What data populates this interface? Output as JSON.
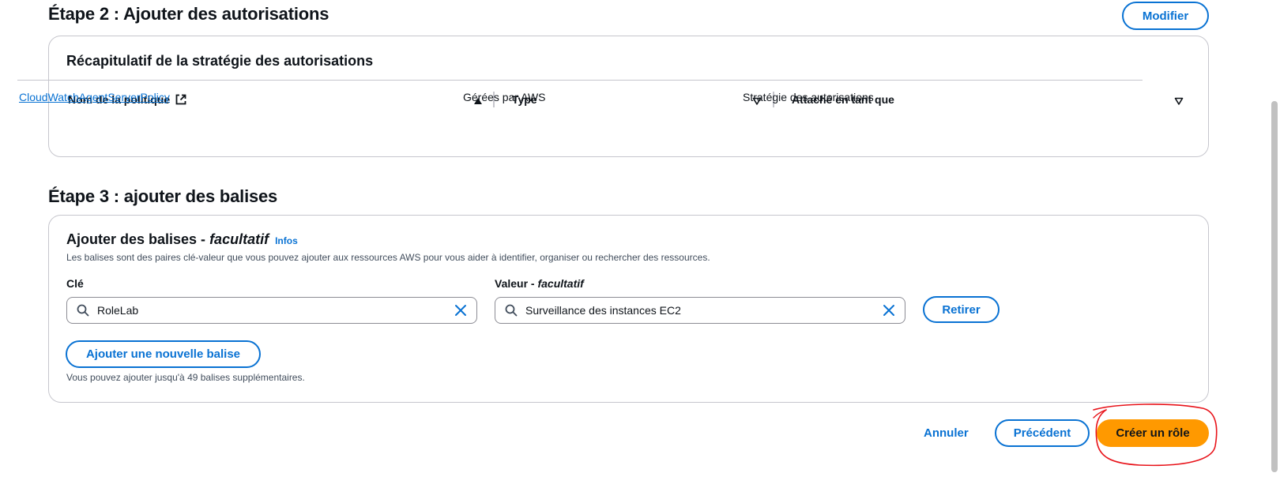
{
  "step2": {
    "title": "Étape 2 : Ajouter des autorisations",
    "edit_label": "Modifier",
    "card": {
      "title": "Récapitulatif de la stratégie des autorisations",
      "columns": [
        {
          "label": "Nom de la politique",
          "sort": "ascending"
        },
        {
          "label": "Type",
          "sort": "none"
        },
        {
          "label": "Attaché en tant que",
          "sort": "none"
        }
      ],
      "rows": [
        {
          "name": "CloudWatchAgentServerPolicy",
          "type": "Gérées par AWS",
          "attached": "Stratégie des autorisations"
        }
      ]
    }
  },
  "step3": {
    "title": "Étape 3 : ajouter des balises",
    "card": {
      "title_main": "Ajouter des balises - ",
      "title_optional": "facultatif",
      "info_link": "Infos",
      "description": "Les balises sont des paires clé-valeur que vous pouvez ajouter aux ressources AWS pour vous aider à identifier, organiser ou rechercher des ressources.",
      "key_label": "Clé",
      "value_label_main": "Valeur - ",
      "value_label_optional": "facultatif",
      "tag": {
        "key": "RoleLab",
        "value": "Surveillance des instances EC2"
      },
      "remove_label": "Retirer",
      "add_tag_label": "Ajouter une nouvelle balise",
      "limit_text": "Vous pouvez ajouter jusqu'à 49 balises supplémentaires."
    }
  },
  "footer": {
    "cancel_label": "Annuler",
    "previous_label": "Précédent",
    "create_label": "Créer un rôle"
  },
  "icons": {
    "external": "external-link-icon",
    "sort_asc": "sort-ascending-icon",
    "sort_none": "sort-descending-icon",
    "search": "search-icon",
    "clear": "close-icon"
  },
  "colors": {
    "link": "#0972d3",
    "primary": "#ff9900",
    "annotation": "#e8131a"
  }
}
